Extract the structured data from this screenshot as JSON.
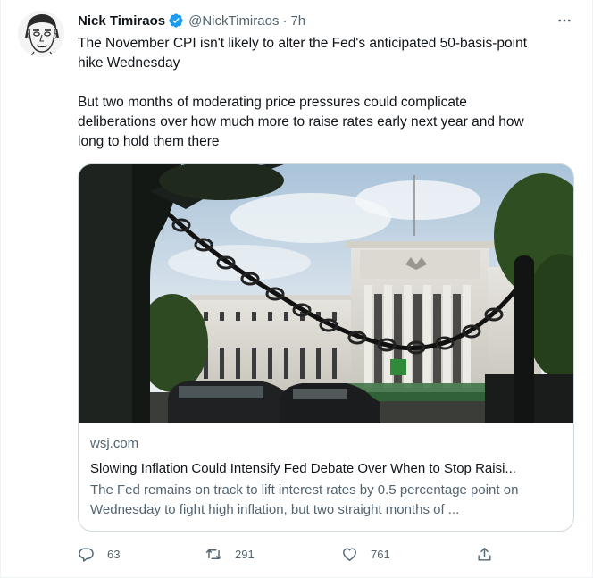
{
  "author": {
    "name": "Nick Timiraos",
    "handle": "@NickTimiraos",
    "separator": "·",
    "time": "7h"
  },
  "tweet": {
    "paragraph1": "The November CPI isn't likely to alter the Fed's anticipated 50-basis-point\nhike Wednesday",
    "paragraph2": "But two months of moderating price pressures could complicate\ndeliberations over how much more to raise rates early next year and how\nlong to hold them there"
  },
  "card": {
    "domain": "wsj.com",
    "title": "Slowing Inflation Could Intensify Fed Debate Over When to Stop Raisi...",
    "description": "The Fed remains on track to lift interest rates by 0.5 percentage point on Wednesday to fight high inflation, but two straight months of ...",
    "image_icon": "federal-reserve-building-photo"
  },
  "actions": {
    "replies": "63",
    "retweets": "291",
    "likes": "761"
  },
  "colors": {
    "text": "#0f1419",
    "secondary": "#536471",
    "verified": "#1d9bf0",
    "border": "#cfd9de"
  }
}
